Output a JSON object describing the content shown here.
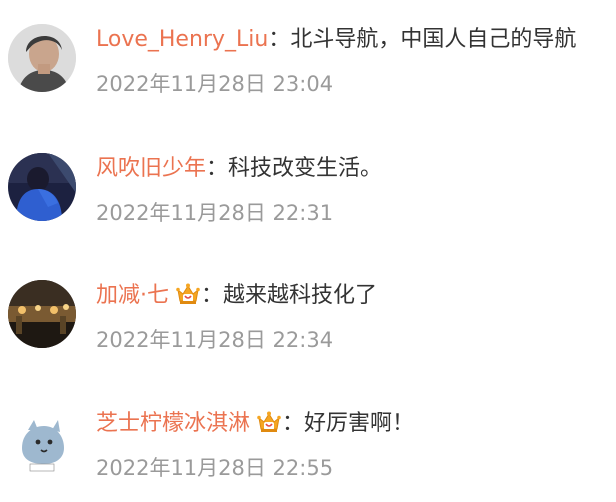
{
  "comments": [
    {
      "username": "Love_Henry_Liu",
      "separator": "：",
      "text": "北斗导航，中国人自己的导航",
      "time": "2022年11月28日 23:04",
      "has_badge": false
    },
    {
      "username": "风吹旧少年",
      "separator": "：",
      "text": "科技改变生活。",
      "time": "2022年11月28日 22:31",
      "has_badge": false
    },
    {
      "username": "加减·七",
      "separator": "：",
      "text": "越来越科技化了",
      "time": "2022年11月28日 22:34",
      "has_badge": true,
      "badge_icon": "vip-crown-icon"
    },
    {
      "username": "芝士柠檬冰淇淋",
      "separator": "：",
      "text": "好厉害啊！",
      "time": "2022年11月28日 22:55",
      "has_badge": true,
      "badge_icon": "vip-crown-icon"
    }
  ],
  "colors": {
    "username": "#eb7350",
    "text": "#333333",
    "time": "#9a9a9a",
    "crown": "#f5a623"
  }
}
